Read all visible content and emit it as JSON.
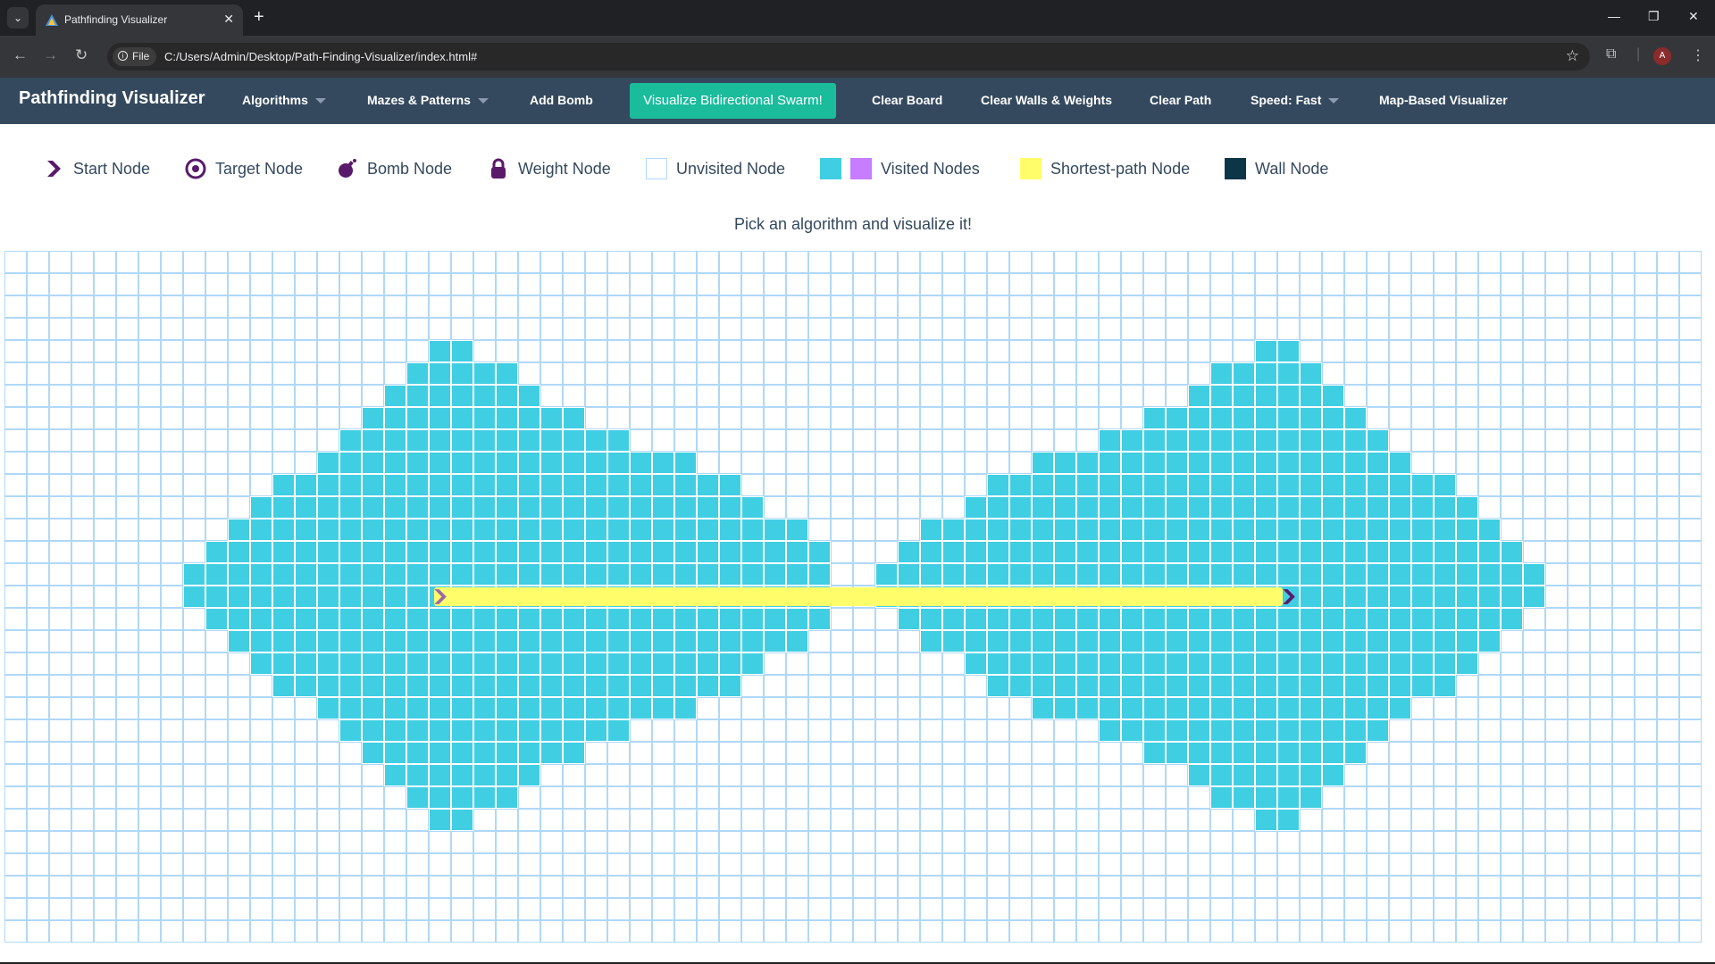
{
  "browser": {
    "tab_title": "Pathfinding Visualizer",
    "file_chip": "File",
    "url": "C:/Users/Admin/Desktop/Path-Finding-Visualizer/index.html#",
    "avatar_letter": "A"
  },
  "navbar": {
    "brand": "Pathfinding Visualizer",
    "algorithms": "Algorithms",
    "mazes": "Mazes & Patterns",
    "add_bomb": "Add Bomb",
    "visualize": "Visualize Bidirectional Swarm!",
    "clear_board": "Clear Board",
    "clear_walls": "Clear Walls & Weights",
    "clear_path": "Clear Path",
    "speed": "Speed: Fast",
    "map_based": "Map-Based Visualizer"
  },
  "legend": {
    "start": "Start Node",
    "target": "Target Node",
    "bomb": "Bomb Node",
    "weight": "Weight Node",
    "unvisited": "Unvisited Node",
    "visited": "Visited Nodes",
    "shortest": "Shortest-path Node",
    "wall": "Wall Node"
  },
  "message": "Pick an algorithm and visualize it!",
  "colors": {
    "navbar": "#34495e",
    "visualize_button": "#1abc9c",
    "visited_a": "#40cee3",
    "visited_b": "#c77dff",
    "shortest_path": "#fffe6a",
    "wall": "#0c3547",
    "grid_line": "#afd8f8",
    "node_icon": "#5a1a6b"
  },
  "grid": {
    "cols": 76,
    "rows": 31,
    "start": {
      "row": 15,
      "col": 19
    },
    "target": {
      "row": 15,
      "col": 57
    },
    "visited_rows": [
      {
        "row": 4,
        "ranges": [
          [
            19,
            20
          ],
          [
            56,
            57
          ]
        ]
      },
      {
        "row": 5,
        "ranges": [
          [
            18,
            22
          ],
          [
            54,
            58
          ]
        ]
      },
      {
        "row": 6,
        "ranges": [
          [
            17,
            23
          ],
          [
            53,
            59
          ]
        ]
      },
      {
        "row": 7,
        "ranges": [
          [
            16,
            25
          ],
          [
            51,
            60
          ]
        ]
      },
      {
        "row": 8,
        "ranges": [
          [
            15,
            27
          ],
          [
            49,
            61
          ]
        ]
      },
      {
        "row": 9,
        "ranges": [
          [
            14,
            30
          ],
          [
            46,
            62
          ]
        ]
      },
      {
        "row": 10,
        "ranges": [
          [
            12,
            32
          ],
          [
            44,
            64
          ]
        ]
      },
      {
        "row": 11,
        "ranges": [
          [
            11,
            33
          ],
          [
            43,
            65
          ]
        ]
      },
      {
        "row": 12,
        "ranges": [
          [
            10,
            35
          ],
          [
            41,
            66
          ]
        ]
      },
      {
        "row": 13,
        "ranges": [
          [
            9,
            36
          ],
          [
            40,
            67
          ]
        ]
      },
      {
        "row": 14,
        "ranges": [
          [
            8,
            36
          ],
          [
            39,
            68
          ]
        ]
      },
      {
        "row": 15,
        "ranges": [
          [
            8,
            36
          ],
          [
            39,
            68
          ]
        ]
      },
      {
        "row": 16,
        "ranges": [
          [
            9,
            36
          ],
          [
            40,
            67
          ]
        ]
      },
      {
        "row": 17,
        "ranges": [
          [
            10,
            35
          ],
          [
            41,
            66
          ]
        ]
      },
      {
        "row": 18,
        "ranges": [
          [
            11,
            33
          ],
          [
            43,
            65
          ]
        ]
      },
      {
        "row": 19,
        "ranges": [
          [
            12,
            32
          ],
          [
            44,
            64
          ]
        ]
      },
      {
        "row": 20,
        "ranges": [
          [
            14,
            30
          ],
          [
            46,
            62
          ]
        ]
      },
      {
        "row": 21,
        "ranges": [
          [
            15,
            27
          ],
          [
            49,
            61
          ]
        ]
      },
      {
        "row": 22,
        "ranges": [
          [
            16,
            25
          ],
          [
            51,
            60
          ]
        ]
      },
      {
        "row": 23,
        "ranges": [
          [
            17,
            23
          ],
          [
            53,
            59
          ]
        ]
      },
      {
        "row": 24,
        "ranges": [
          [
            18,
            22
          ],
          [
            54,
            58
          ]
        ]
      },
      {
        "row": 25,
        "ranges": [
          [
            19,
            20
          ],
          [
            56,
            57
          ]
        ]
      }
    ]
  }
}
